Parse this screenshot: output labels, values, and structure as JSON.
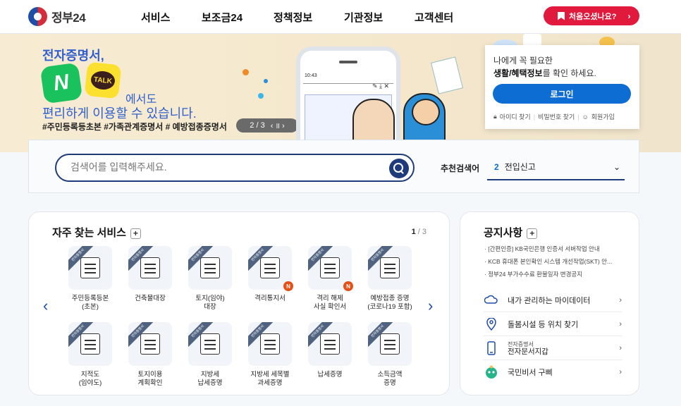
{
  "header": {
    "logo_text": "정부24",
    "nav": [
      "서비스",
      "보조금24",
      "정책정보",
      "기관정보",
      "고객센터"
    ],
    "first_visit_button": "처음오셨나요?",
    "first_visit_arrow": "›"
  },
  "banner": {
    "line1": "전자증명서,",
    "naver_letter": "N",
    "kakao_text": "TALK",
    "line2": "에서도",
    "line3": "편리하게 이용할 수 있습니다.",
    "hashtags": "#주민등록등초본 #가족관계증명서 # 예방접종증명서",
    "pager": "2 / 3",
    "pager_controls": "‹  ॥  ›",
    "phone_time": "10:43",
    "phone_tools": "✎ ⤓ ✕"
  },
  "login_box": {
    "line1": "나에게 꼭 필요한",
    "line2_bold": "생활/혜택정보",
    "line2_rest": "를 확인 하세요.",
    "login_button": "로그인",
    "find_id": "아이디 찾기",
    "find_pw": "비밀번호 찾기",
    "join": "회원가입"
  },
  "search": {
    "placeholder": "검색어를 입력해주세요.",
    "recommended_label": "추천검색어",
    "recommended_rank": "2",
    "recommended_term": "전입신고",
    "dropdown_chevron": "⌄"
  },
  "favorites": {
    "title": "자주 찾는 서비스",
    "plus": "+",
    "page_current": "1",
    "page_total": "/ 3",
    "ribbon": "전자증명서",
    "items": [
      {
        "label1": "주민등록등본",
        "label2": "(초본)",
        "badge": ""
      },
      {
        "label1": "건축물대장",
        "label2": "",
        "badge": ""
      },
      {
        "label1": "토지(임야)",
        "label2": "대장",
        "badge": ""
      },
      {
        "label1": "격리통지서",
        "label2": "",
        "badge": "N"
      },
      {
        "label1": "격리 해제",
        "label2": "사실 확인서",
        "badge": "N"
      },
      {
        "label1": "예방접종 증명",
        "label2": "(코로나19 포함)",
        "badge": ""
      },
      {
        "label1": "지적도",
        "label2": "(임야도)",
        "badge": ""
      },
      {
        "label1": "토지이용",
        "label2": "계획확인",
        "badge": ""
      },
      {
        "label1": "지방세",
        "label2": "납세증명",
        "badge": ""
      },
      {
        "label1": "지방세 세목별",
        "label2": "과세증명",
        "badge": ""
      },
      {
        "label1": "납세증명",
        "label2": "",
        "badge": ""
      },
      {
        "label1": "소득금액",
        "label2": "증명",
        "badge": ""
      }
    ]
  },
  "notice": {
    "title": "공지사항",
    "plus": "+",
    "items": [
      "[간편인증] KB국민은행 인증서 서버작업 안내",
      "KCB 휴대폰 본인확인 시스템 개선작업(SKT) 안...",
      "정부24 부가수수료 환불일자 변경공지"
    ],
    "links": [
      {
        "label": "내가 관리하는 마이데이터",
        "small": ""
      },
      {
        "label": "돌봄시설 등 위치 찾기",
        "small": ""
      },
      {
        "label": "전자문서지갑",
        "small": "전자증명서"
      },
      {
        "label": "국민비서 구삐",
        "small": ""
      }
    ]
  },
  "colors": {
    "brand_red": "#e0193d",
    "primary_blue": "#0e6dd3",
    "navy": "#1f3c7a"
  }
}
